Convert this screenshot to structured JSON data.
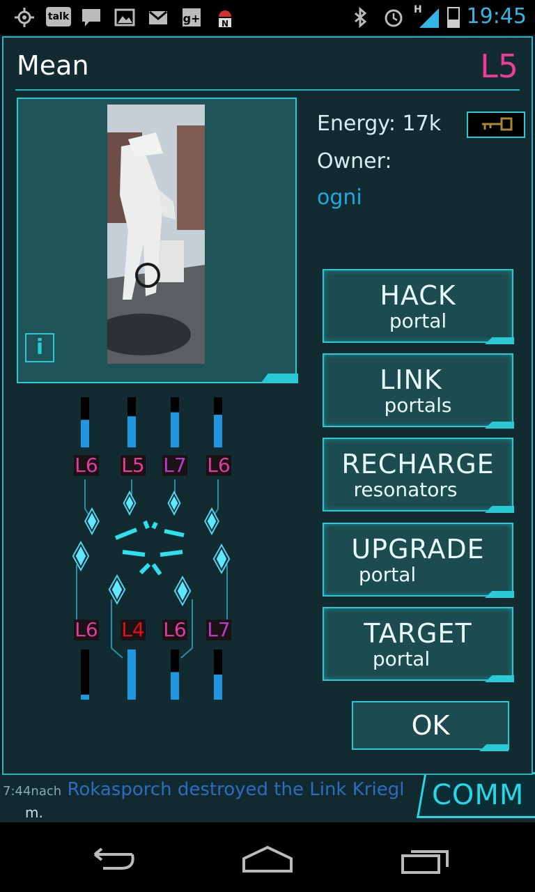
{
  "status_bar": {
    "time": "19:45",
    "talk_label": "talk",
    "network_label": "H",
    "icons": [
      "gps-icon",
      "talk-icon",
      "chat-icon",
      "gallery-icon",
      "gmail-icon",
      "gplus-icon",
      "android-n-icon",
      "bluetooth-icon",
      "alarm-icon",
      "signal-icon",
      "battery-icon"
    ]
  },
  "dialog": {
    "title": "Mean",
    "level": "L5",
    "energy_label": "Energy:",
    "energy_value": "17k",
    "owner_label": "Owner:",
    "owner_name": "ogni",
    "info_label": "i"
  },
  "actions": [
    {
      "main": "HACK",
      "sub": "portal"
    },
    {
      "main": "LINK",
      "sub": "portals"
    },
    {
      "main": "RECHARGE",
      "sub": "resonators"
    },
    {
      "main": "UPGRADE",
      "sub": "portal"
    },
    {
      "main": "TARGET",
      "sub": "portal"
    }
  ],
  "ok_label": "OK",
  "resonators_top": [
    {
      "level": "L6",
      "fill": 0.55,
      "color": "#e03ca0"
    },
    {
      "level": "L5",
      "fill": 0.62,
      "color": "#ec3c96"
    },
    {
      "level": "L7",
      "fill": 0.7,
      "color": "#b93bc9"
    },
    {
      "level": "L6",
      "fill": 0.65,
      "color": "#e03ca0"
    }
  ],
  "resonators_bottom": [
    {
      "level": "L6",
      "fill": 0.1,
      "color": "#e03ca0"
    },
    {
      "level": "L4",
      "fill": 1.0,
      "color": "#e31212"
    },
    {
      "level": "L6",
      "fill": 0.55,
      "color": "#e03ca0"
    },
    {
      "level": "L7",
      "fill": 0.5,
      "color": "#b93bc9"
    }
  ],
  "ticker": {
    "time": "7:44nach",
    "text": "Rokasporch destroyed the Link Kriegl",
    "continuation": "m.",
    "comm_label": "COMM"
  },
  "nav": [
    "back-icon",
    "home-icon",
    "recent-apps-icon"
  ],
  "colors": {
    "accent": "#29c9d6",
    "magenta": "#ec3c96",
    "blue": "#1fa9e0"
  }
}
